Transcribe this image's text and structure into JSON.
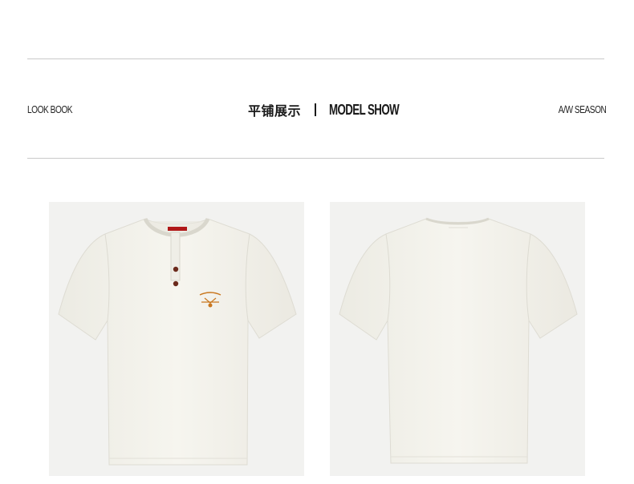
{
  "header": {
    "left_label": "LOOK BOOK",
    "title_cn": "平铺展示",
    "separator": "|",
    "title_en": "MODEL SHOW",
    "right_label": "A/W SEASON"
  },
  "photos": [
    {
      "view": "front",
      "icon": "henley-tshirt-front-image",
      "color": "#f3f1ea"
    },
    {
      "view": "back",
      "icon": "tshirt-back-image",
      "color": "#f3f1ea"
    }
  ],
  "colors": {
    "rule": "#c9c9c9",
    "photo_background": "#f2f2f0",
    "shirt": "#f3f1ea",
    "embroidery": "#c9771f",
    "buttons": "#6b2a1c",
    "tag": "#b01818"
  }
}
